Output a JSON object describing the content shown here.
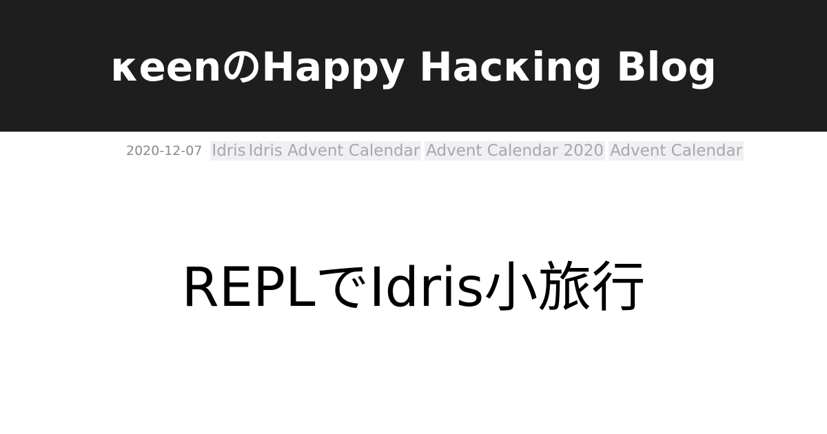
{
  "header": {
    "site_title": "κeenのHappy Hacκing Blog"
  },
  "meta": {
    "date": "2020-12-07",
    "tags": [
      "Idris",
      "Idris Advent Calendar",
      "Advent Calendar 2020",
      "Advent Calendar"
    ]
  },
  "post": {
    "title": "REPLでIdris小旅行"
  }
}
